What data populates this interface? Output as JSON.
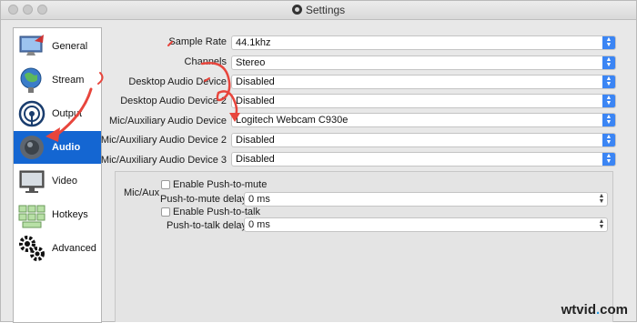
{
  "window": {
    "title": "Settings"
  },
  "sidebar": {
    "items": [
      {
        "label": "General",
        "icon": "monitor-icon"
      },
      {
        "label": "Stream",
        "icon": "globe-icon"
      },
      {
        "label": "Output",
        "icon": "antenna-icon"
      },
      {
        "label": "Audio",
        "icon": "speaker-icon",
        "selected": true
      },
      {
        "label": "Video",
        "icon": "display-icon"
      },
      {
        "label": "Hotkeys",
        "icon": "keyboard-icon"
      },
      {
        "label": "Advanced",
        "icon": "gears-icon"
      }
    ]
  },
  "audio": {
    "sample_rate": {
      "label": "Sample Rate",
      "value": "44.1khz"
    },
    "channels": {
      "label": "Channels",
      "value": "Stereo"
    },
    "desktop_audio": {
      "label": "Desktop Audio Device",
      "value": "Disabled"
    },
    "desktop_audio_2": {
      "label": "Desktop Audio Device 2",
      "value": "Disabled"
    },
    "mic_aux": {
      "label": "Mic/Auxiliary Audio Device",
      "value": "Logitech Webcam C930e"
    },
    "mic_aux_2": {
      "label": "Mic/Auxiliary Audio Device 2",
      "value": "Disabled"
    },
    "mic_aux_3": {
      "label": "Mic/Auxiliary Audio Device 3",
      "value": "Disabled"
    }
  },
  "mic_group": {
    "title": "Mic/Aux",
    "push_to_mute_label": "Enable Push-to-mute",
    "push_to_mute_delay_label": "Push-to-mute delay",
    "push_to_mute_delay_value": "0 ms",
    "push_to_talk_label": "Enable Push-to-talk",
    "push_to_talk_delay_label": "Push-to-talk delay",
    "push_to_talk_delay_value": "0 ms"
  },
  "watermark": {
    "prefix": "wtvid",
    "dot": ".",
    "suffix": "com"
  },
  "colors": {
    "selection": "#1466d2",
    "annotation": "#e8453c",
    "stepper": "#3b85f4"
  }
}
